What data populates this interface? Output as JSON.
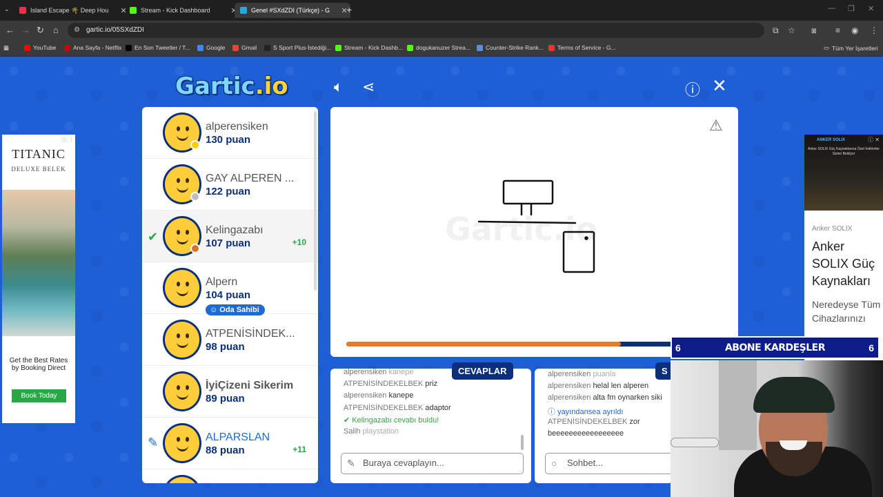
{
  "browser": {
    "tabs": [
      {
        "label": "Island Escape 🌴 Deep Hou",
        "color": "#e8304a",
        "active": false
      },
      {
        "label": "Stream - Kick Dashboard",
        "color": "#53fc18",
        "active": false
      },
      {
        "label": "Genel #SXdZDI (Türkçe) - G",
        "color": "#2aa7e0",
        "active": true
      }
    ],
    "url": "gartic.io/05SXdZDI",
    "bookmarks": [
      {
        "label": "YouTube",
        "color": "#ff0000"
      },
      {
        "label": "Ana Sayfa - Netflix",
        "color": "#c40812"
      },
      {
        "label": "En Son Tweetler / T...",
        "color": "#000000"
      },
      {
        "label": "Google",
        "color": "#4285f4"
      },
      {
        "label": "Gmail",
        "color": "#ea4335"
      },
      {
        "label": "S Sport Plus-İstediği...",
        "color": "#222222"
      },
      {
        "label": "Stream - Kick Dashb...",
        "color": "#53fc18"
      },
      {
        "label": "dogukanuzer Strea...",
        "color": "#53fc18"
      },
      {
        "label": "Counter-Strike Rank...",
        "color": "#5b8fd6"
      },
      {
        "label": "Terms of Service - G...",
        "color": "#e33"
      }
    ],
    "all_bookmarks": "Tüm Yer İşaretleri"
  },
  "game": {
    "logo_main": "Gartic",
    "logo_suffix": ".io",
    "watermark": "Gartic.io",
    "progress": 0.73,
    "players": [
      {
        "name": "alperensiken",
        "points": "130 puan",
        "badge_color": "#ffcc00",
        "status": "",
        "plus": ""
      },
      {
        "name": "GAY ALPEREN ...",
        "points": "122 puan",
        "badge_color": "#bdbdbd",
        "status": "",
        "plus": ""
      },
      {
        "name": "Kelingazabı",
        "points": "107 puan",
        "badge_color": "#e0701e",
        "status": "correct",
        "plus": "+10"
      },
      {
        "name": "Alpern",
        "points": "104 puan",
        "badge_color": "",
        "status": "",
        "plus": "",
        "host": "Oda Sahibi"
      },
      {
        "name": "ATPENİSİNDEK...",
        "points": "98 puan",
        "badge_color": "",
        "status": "",
        "plus": ""
      },
      {
        "name": "İyiÇizeni Sikerim",
        "points": "89 puan",
        "badge_color": "",
        "status": "",
        "plus": ""
      },
      {
        "name": "ALPARSLAN",
        "points": "88 puan",
        "badge_color": "",
        "status": "drawing",
        "plus": "+11"
      }
    ],
    "answers_tab": "CEVAPLAR",
    "answers": [
      {
        "user": "alperensiken",
        "text": "kanepe",
        "kind": "fade"
      },
      {
        "user": "ATPENİSİNDEKELBEK",
        "text": "priz",
        "kind": "normal"
      },
      {
        "user": "alperensiken",
        "text": "kanepe",
        "kind": "normal"
      },
      {
        "user": "ATPENİSİNDEKELBEK",
        "text": "adaptor",
        "kind": "normal"
      },
      {
        "user": "Kelingazabı",
        "text": "cevabı buldu!",
        "kind": "green"
      },
      {
        "user": "Salih",
        "text": "playstation",
        "kind": "fade"
      }
    ],
    "answer_placeholder": "Buraya cevaplayın...",
    "chat": [
      {
        "user": "alperensiken",
        "text": "puanla",
        "kind": "fade"
      },
      {
        "user": "alperensiken",
        "text": "helal len alperen",
        "kind": "normal"
      },
      {
        "user": "alperensiken",
        "text": "alta fm oynarken siki",
        "kind": "normal"
      },
      {
        "user": "yayındansea",
        "text": "ayrıldı",
        "kind": "blue"
      },
      {
        "user": "ATPENİSİNDEKELBEK",
        "text": "zor",
        "kind": "normal"
      },
      {
        "user": "",
        "text": "beeeeeeeeeeeeeeeee",
        "kind": "normal"
      }
    ],
    "chat_placeholder": "Sohbet..."
  },
  "ad_left": {
    "title": "TITANIC",
    "subtitle": "DELUXE BELEK",
    "copy": "Get the Best Rates by Booking Direct",
    "button": "Book Today"
  },
  "ad_right": {
    "brand": "ANKER SOLIX",
    "fine": "Anker SOLIX Güç Kaynaklarına Özel İndirimler Sizleri Bekliyor",
    "label": "Anker SOLIX",
    "headline": "Anker SOLIX Güç Kaynakları",
    "body": "Neredeyse Tüm Cihazlarınızı"
  },
  "stream_overlay": {
    "left_num": "6",
    "text": "ABONE KARDEŞLER",
    "right_num": "6"
  }
}
